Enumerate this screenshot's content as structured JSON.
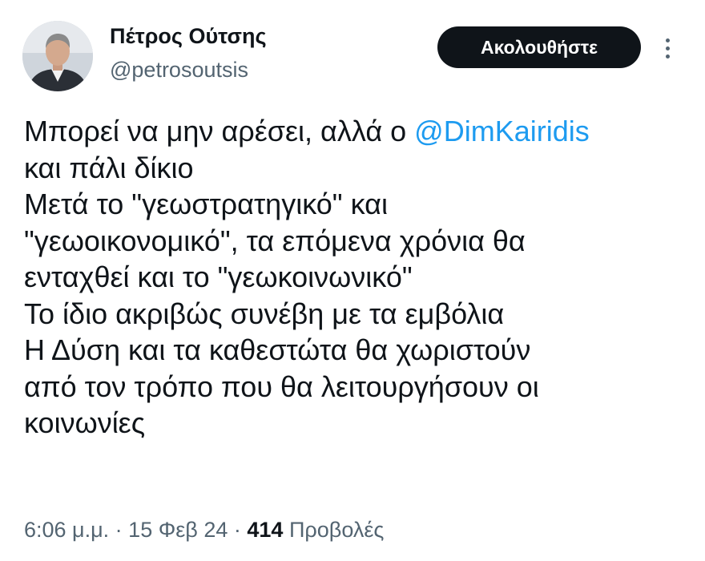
{
  "author": {
    "name": "Πέτρος Ούτσης",
    "handle": "@petrosoutsis"
  },
  "header": {
    "follow_label": "Ακολουθήστε",
    "more_icon": "more-vertical-icon"
  },
  "tweet": {
    "line1_prefix": "Μπορεί να μην αρέσει, αλλά ο ",
    "mention": "@DimKairidis",
    "lines": [
      "και πάλι δίκιο",
      "Μετά το \"γεωστρατηγικό\" και",
      "\"γεωοικονομικό\", τα επόμενα χρόνια θα",
      "ενταχθεί και το \"γεωκοινωνικό\"",
      "Το ίδιο ακριβώς συνέβη με τα εμβόλια",
      "Η Δύση και τα καθεστώτα θα χωριστούν",
      "από τον τρόπο που θα λειτουργήσουν οι",
      "κοινωνίες"
    ]
  },
  "meta": {
    "time": "6:06 μ.μ.",
    "separator": " · ",
    "date": "15 Φεβ 24",
    "views_count": "414",
    "views_label": "Προβολές"
  },
  "colors": {
    "text": "#0f1419",
    "secondary": "#536471",
    "link": "#1d9bf0",
    "button_bg": "#0f1419",
    "button_text": "#ffffff"
  }
}
